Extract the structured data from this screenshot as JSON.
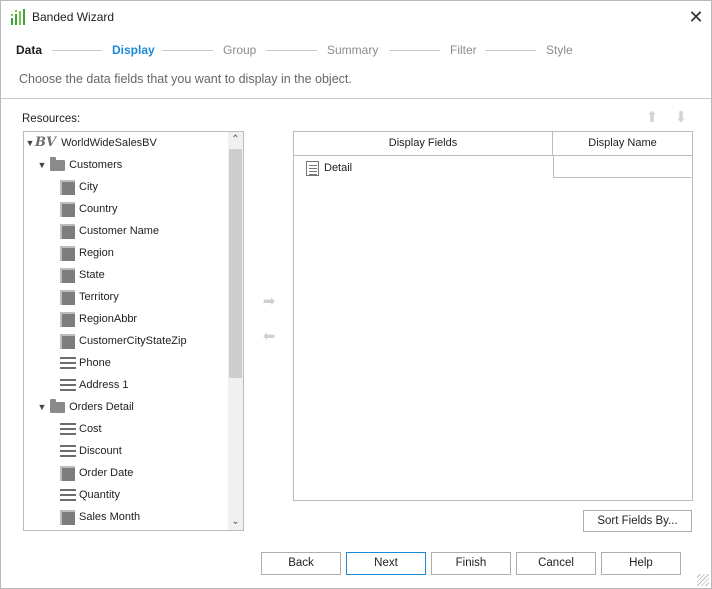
{
  "window": {
    "title": "Banded Wizard",
    "app_icon": "bar-chart-icon",
    "close_icon": "close-icon"
  },
  "steps": [
    {
      "label": "Data",
      "state": "done"
    },
    {
      "label": "Display",
      "state": "active"
    },
    {
      "label": "Group",
      "state": "inactive"
    },
    {
      "label": "Summary",
      "state": "inactive"
    },
    {
      "label": "Filter",
      "state": "inactive"
    },
    {
      "label": "Style",
      "state": "inactive"
    }
  ],
  "instruction": "Choose the data fields that you want to display in the object.",
  "resources": {
    "label": "Resources:",
    "tree": [
      {
        "label": "WorldWideSalesBV",
        "icon": "business-view-icon",
        "level": 0,
        "expanded": true
      },
      {
        "label": "Customers",
        "icon": "folder-icon",
        "level": 1,
        "expanded": true
      },
      {
        "label": "City",
        "icon": "dimension-field-icon",
        "level": 2
      },
      {
        "label": "Country",
        "icon": "dimension-field-icon",
        "level": 2
      },
      {
        "label": "Customer Name",
        "icon": "dimension-field-icon",
        "level": 2
      },
      {
        "label": "Region",
        "icon": "dimension-field-icon",
        "level": 2
      },
      {
        "label": "State",
        "icon": "dimension-field-icon",
        "level": 2
      },
      {
        "label": "Territory",
        "icon": "dimension-field-icon",
        "level": 2
      },
      {
        "label": "RegionAbbr",
        "icon": "dimension-field-icon",
        "level": 2
      },
      {
        "label": "CustomerCityStateZip",
        "icon": "dimension-field-icon",
        "level": 2
      },
      {
        "label": "Phone",
        "icon": "detail-field-icon",
        "level": 2
      },
      {
        "label": "Address 1",
        "icon": "detail-field-icon",
        "level": 2
      },
      {
        "label": "Orders Detail",
        "icon": "folder-icon",
        "level": 1,
        "expanded": true
      },
      {
        "label": "Cost",
        "icon": "detail-field-icon",
        "level": 2
      },
      {
        "label": "Discount",
        "icon": "detail-field-icon",
        "level": 2
      },
      {
        "label": "Order Date",
        "icon": "dimension-field-icon",
        "level": 2
      },
      {
        "label": "Quantity",
        "icon": "detail-field-icon",
        "level": 2
      },
      {
        "label": "Sales Month",
        "icon": "dimension-field-icon",
        "level": 2
      }
    ]
  },
  "display_table": {
    "columns": [
      "Display Fields",
      "Display Name"
    ],
    "rows": [
      {
        "field": "Detail",
        "name": "",
        "icon": "detail-table-icon"
      }
    ]
  },
  "move_controls": {
    "add_icon": "arrow-right-icon",
    "remove_icon": "arrow-left-icon",
    "up_icon": "arrow-up-icon",
    "down_icon": "arrow-down-icon"
  },
  "sort_button": "Sort Fields By...",
  "footer": {
    "back": "Back",
    "next": "Next",
    "finish": "Finish",
    "cancel": "Cancel",
    "help": "Help"
  },
  "colors": {
    "active_step": "#1c8ad6",
    "primary_border": "#1c8ad6"
  }
}
